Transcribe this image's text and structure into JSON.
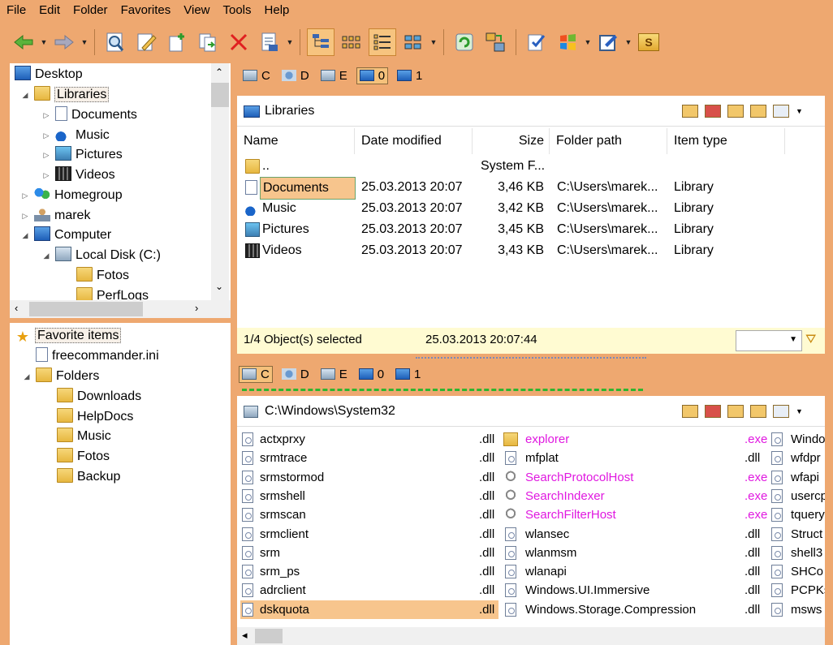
{
  "menu": [
    "File",
    "Edit",
    "Folder",
    "Favorites",
    "View",
    "Tools",
    "Help"
  ],
  "toolbar": {
    "icons": [
      "back-arrow-icon",
      "forward-arrow-icon",
      "find-icon",
      "edit-icon",
      "new-file-icon",
      "copy-icon",
      "delete-icon",
      "view-file-icon",
      "tree-view-icon",
      "large-icons-icon",
      "details-view-icon",
      "thumbnails-icon",
      "refresh-icon",
      "sync-icon",
      "favorites-icon",
      "windows-icon",
      "notepad-icon",
      "script-icon"
    ],
    "script_label": "S"
  },
  "tree": {
    "items": [
      {
        "label": "Desktop"
      },
      {
        "label": "Libraries"
      },
      {
        "label": "Documents"
      },
      {
        "label": "Music"
      },
      {
        "label": "Pictures"
      },
      {
        "label": "Videos"
      },
      {
        "label": "Homegroup"
      },
      {
        "label": "marek"
      },
      {
        "label": "Computer"
      },
      {
        "label": "Local Disk (C:)"
      },
      {
        "label": "Fotos"
      },
      {
        "label": "PerfLogs"
      }
    ]
  },
  "favorites": {
    "title": "Favorite items",
    "items": [
      {
        "label": "freecommander.ini"
      },
      {
        "label": "Folders"
      },
      {
        "label": "Downloads"
      },
      {
        "label": "HelpDocs"
      },
      {
        "label": "Music"
      },
      {
        "label": "Fotos"
      },
      {
        "label": "Backup"
      }
    ]
  },
  "drives": [
    "C",
    "D",
    "E",
    "0",
    "1"
  ],
  "top_pane": {
    "title": "Libraries",
    "columns": [
      "Name",
      "Date modified",
      "Size",
      "Folder path",
      "Item type"
    ],
    "rows": [
      {
        "name": "..",
        "date": "",
        "size": "System F...",
        "path": "",
        "type": ""
      },
      {
        "name": "Documents",
        "date": "25.03.2013 20:07",
        "size": "3,46 KB",
        "path": "C:\\Users\\marek...",
        "type": "Library"
      },
      {
        "name": "Music",
        "date": "25.03.2013 20:07",
        "size": "3,42 KB",
        "path": "C:\\Users\\marek...",
        "type": "Library"
      },
      {
        "name": "Pictures",
        "date": "25.03.2013 20:07",
        "size": "3,45 KB",
        "path": "C:\\Users\\marek...",
        "type": "Library"
      },
      {
        "name": "Videos",
        "date": "25.03.2013 20:07",
        "size": "3,43 KB",
        "path": "C:\\Users\\marek...",
        "type": "Library"
      }
    ],
    "status": "1/4 Object(s) selected",
    "status_date": "25.03.2013 20:07:44"
  },
  "bottom_pane": {
    "title": "C:\\Windows\\System32",
    "col1": [
      {
        "name": "actxprxy",
        "ext": ".dll"
      },
      {
        "name": "srmtrace",
        "ext": ".dll"
      },
      {
        "name": "srmstormod",
        "ext": ".dll"
      },
      {
        "name": "srmshell",
        "ext": ".dll"
      },
      {
        "name": "srmscan",
        "ext": ".dll"
      },
      {
        "name": "srmclient",
        "ext": ".dll"
      },
      {
        "name": "srm",
        "ext": ".dll"
      },
      {
        "name": "srm_ps",
        "ext": ".dll"
      },
      {
        "name": "adrclient",
        "ext": ".dll"
      },
      {
        "name": "dskquota",
        "ext": ".dll"
      }
    ],
    "col2": [
      {
        "name": "explorer",
        "ext": ".exe"
      },
      {
        "name": "mfplat",
        "ext": ".dll"
      },
      {
        "name": "SearchProtocolHost",
        "ext": ".exe"
      },
      {
        "name": "SearchIndexer",
        "ext": ".exe"
      },
      {
        "name": "SearchFilterHost",
        "ext": ".exe"
      },
      {
        "name": "wlansec",
        "ext": ".dll"
      },
      {
        "name": "wlanmsm",
        "ext": ".dll"
      },
      {
        "name": "wlanapi",
        "ext": ".dll"
      },
      {
        "name": "Windows.UI.Immersive",
        "ext": ".dll"
      },
      {
        "name": "Windows.Storage.Compression",
        "ext": ".dll"
      }
    ],
    "col3": [
      "Windo",
      "wfdpr",
      "wfapi",
      "usercp",
      "tquery",
      "Struct",
      "shell3",
      "SHCo",
      "PCPKs",
      "msws"
    ]
  },
  "colors": {
    "accent": "#eea870",
    "selection": "#f7c58d",
    "status_bg": "#fffbd2",
    "exe_text": "#e018e0"
  }
}
